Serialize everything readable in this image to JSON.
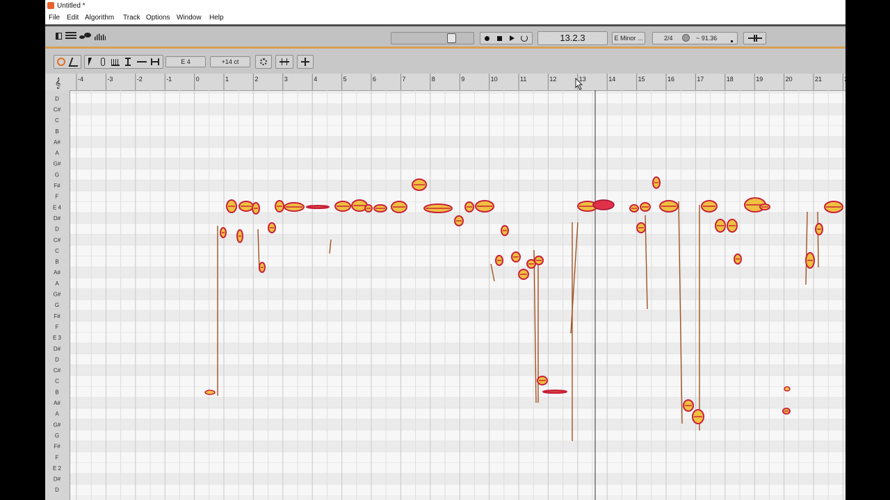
{
  "window": {
    "title": "Untitled *"
  },
  "menu": [
    "File",
    "Edit",
    "Algorithm",
    "Track",
    "Options",
    "Window",
    "Help"
  ],
  "transport": {
    "position": "13.2.3",
    "key": "E Minor ...",
    "time_signature": "2/4",
    "tempo": "~ 91.36"
  },
  "edit_toolbar": {
    "pitch_field": "E 4",
    "cents_field": "+14 ct"
  },
  "ruler_labels": [
    "-4",
    "-3",
    "-2",
    "-1",
    "0",
    "1",
    "2",
    "3",
    "4",
    "5",
    "6",
    "7",
    "8",
    "9",
    "10",
    "11",
    "12",
    "13",
    "14",
    "15",
    "16",
    "17",
    "18",
    "19",
    "20",
    "21",
    "2"
  ],
  "note_labels": [
    "D",
    "C#",
    "C",
    "B",
    "A#",
    "A",
    "G#",
    "G",
    "F#",
    "F",
    "E 4",
    "D#",
    "D",
    "C#",
    "C",
    "B",
    "A#",
    "A",
    "G#",
    "G",
    "F#",
    "F",
    "E 3",
    "D#",
    "D",
    "C#",
    "C",
    "B",
    "A#",
    "A",
    "G#",
    "G",
    "F#",
    "F",
    "E 2",
    "D#",
    "D"
  ],
  "colors": {
    "blob_fill": "#f0c040",
    "blob_edge": "#c8203a",
    "blob_core": "#e0304a",
    "pitch_line": "#a05020"
  },
  "icons": {
    "view_buttons": [
      "layout-icon",
      "tracks-icon",
      "blobs-icon",
      "waveform-icon"
    ],
    "transport": [
      "record-icon",
      "stop-icon",
      "play-icon",
      "loop-icon"
    ],
    "tools": [
      "link-icon",
      "curve-icon",
      "arrow-tool-icon",
      "pitch-tool-icon",
      "amplitude-tool-icon",
      "time-tool-icon",
      "formant-tool-icon",
      "stretch-tool-icon"
    ]
  }
}
